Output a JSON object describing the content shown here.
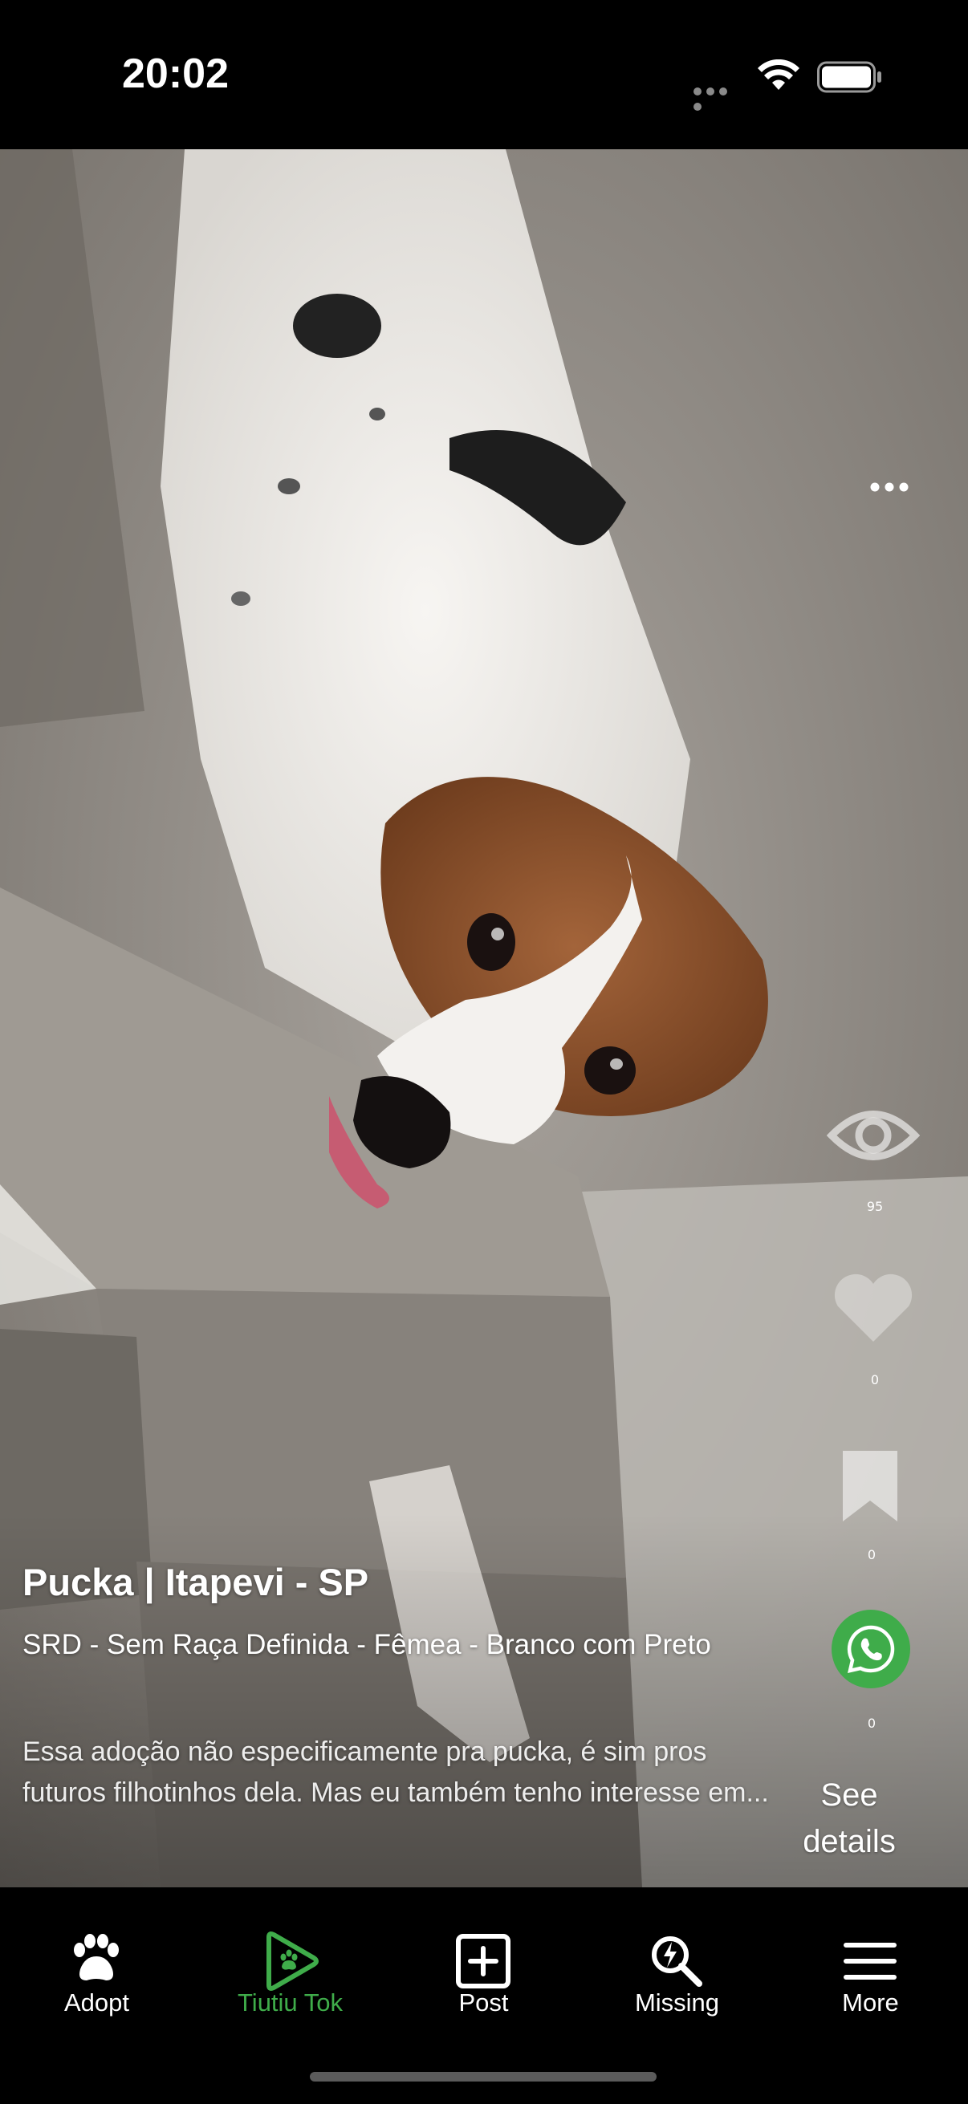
{
  "status_bar": {
    "time": "20:02"
  },
  "post": {
    "title": "Pucka | Itapevi - SP",
    "subtitle": "SRD - Sem Raça Definida - Fêmea - Branco com Preto",
    "description": "Essa adoção não especificamente pra pucka, é sim pros futuros filhotinhos dela. Mas eu também tenho interesse em..."
  },
  "actions": {
    "views_count": "95",
    "likes_count": "0",
    "saves_count": "0",
    "whatsapp_count": "0",
    "see_details_label": "See details"
  },
  "tab_bar": {
    "items": [
      {
        "label": "Adopt",
        "icon": "paw-icon"
      },
      {
        "label": "Tiutiu Tok",
        "icon": "play-paw-icon"
      },
      {
        "label": "Post",
        "icon": "plus-square-icon"
      },
      {
        "label": "Missing",
        "icon": "search-bolt-icon"
      },
      {
        "label": "More",
        "icon": "menu-icon"
      }
    ],
    "active_index": 1
  },
  "colors": {
    "accent": "#3fac4a",
    "background": "#000000"
  }
}
